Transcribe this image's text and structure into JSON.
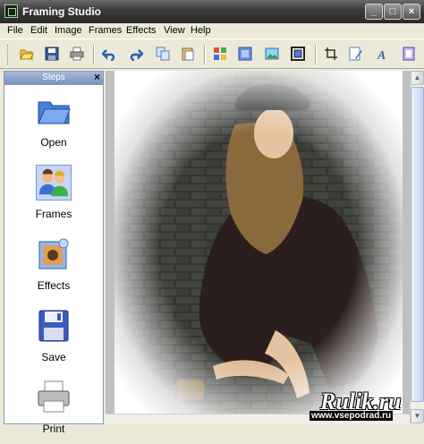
{
  "window": {
    "title": "Framing Studio"
  },
  "menu": [
    "File",
    "Edit",
    "Image",
    "Frames",
    "Effects",
    "View",
    "Help"
  ],
  "toolbar": {
    "buttons": [
      "open-icon",
      "save-icon",
      "print-icon",
      "undo-icon",
      "redo-icon",
      "copy-icon",
      "paste-icon",
      "frame-select-icon",
      "color-fill-icon",
      "picture-icon",
      "border-icon",
      "crop-icon",
      "edit-image-icon",
      "text-icon",
      "layer-icon"
    ]
  },
  "steps_panel": {
    "title": "Steps",
    "items": [
      {
        "label": "Open",
        "icon": "folder-icon",
        "selected": false
      },
      {
        "label": "Frames",
        "icon": "users-icon",
        "selected": true
      },
      {
        "label": "Effects",
        "icon": "effects-icon",
        "selected": false
      },
      {
        "label": "Save",
        "icon": "floppy-disk-icon",
        "selected": false
      },
      {
        "label": "Print",
        "icon": "printer-icon",
        "selected": false
      }
    ]
  },
  "watermark": {
    "brand": "Rulik.ru",
    "site": "www.vsepodrad.ru"
  },
  "colors": {
    "titlebar": "#3a3a3a",
    "accent_selection": "#c7d6f5",
    "panel_header": "#8aa0cc"
  }
}
